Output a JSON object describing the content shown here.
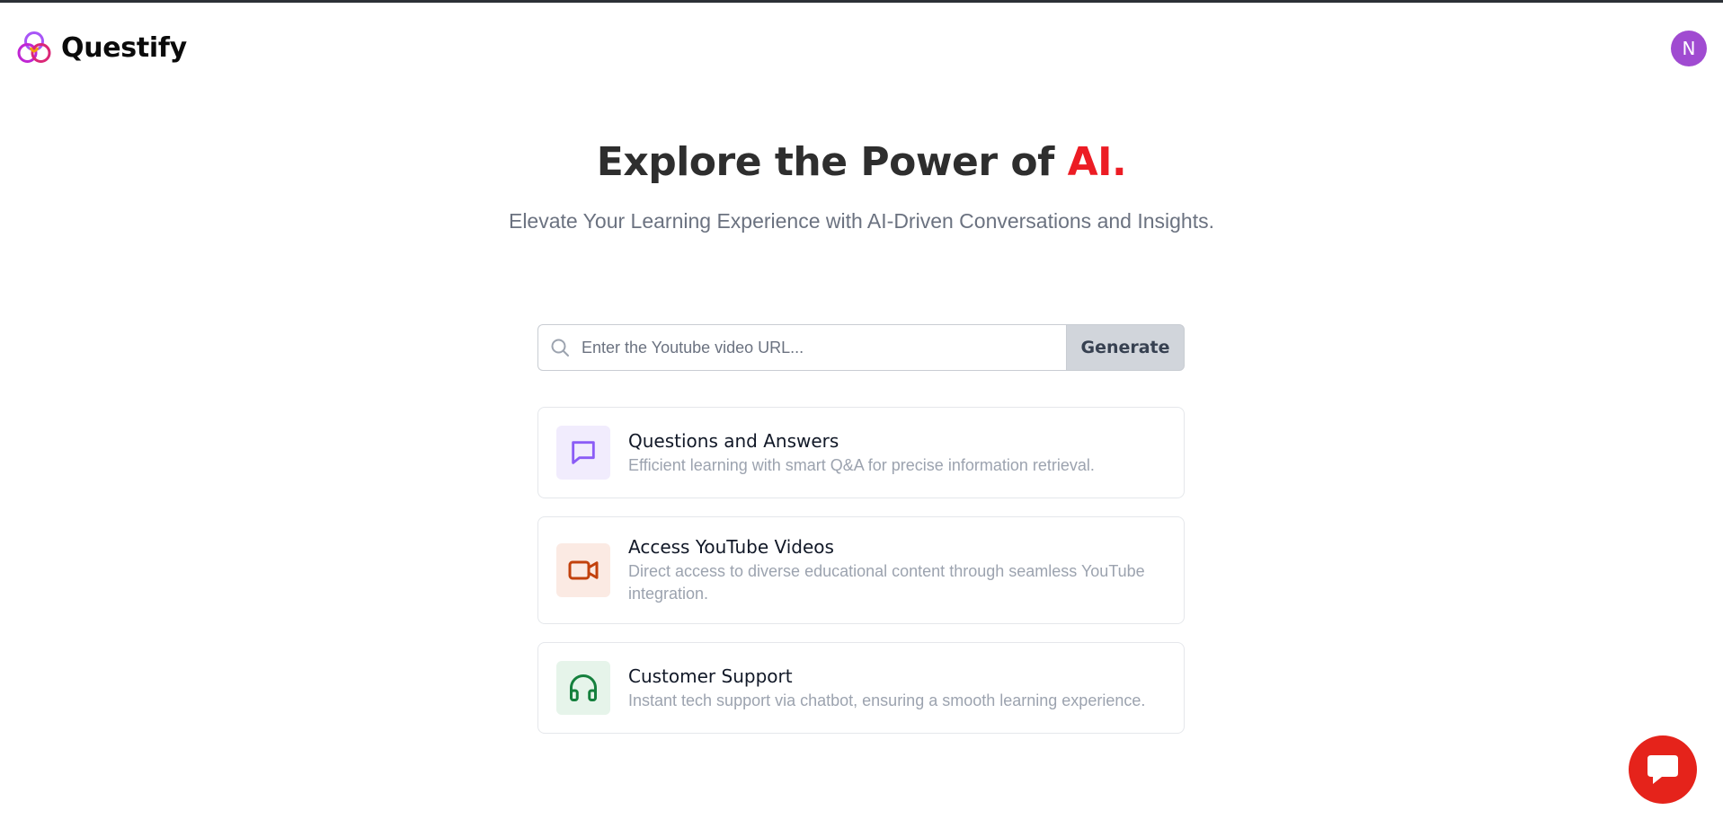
{
  "brand": {
    "name": "Questify",
    "logo_icon": "interlocking-rings-logo"
  },
  "user": {
    "avatar_initial": "N",
    "avatar_color": "#a04bd1"
  },
  "hero": {
    "title_prefix": "Explore the Power of ",
    "title_accent": "AI.",
    "accent_color": "#ec1c24",
    "subtitle": "Elevate Your Learning Experience with AI-Driven Conversations and Insights."
  },
  "search": {
    "placeholder": "Enter the Youtube video URL...",
    "value": "",
    "icon": "search-icon",
    "button_label": "Generate"
  },
  "features": [
    {
      "title": "Questions and Answers",
      "description": "Efficient learning with smart Q&A for precise information retrieval.",
      "icon": "chat-bubble-icon",
      "color": "#8b5cf6"
    },
    {
      "title": "Access YouTube Videos",
      "description": "Direct access to diverse educational content through seamless YouTube integration.",
      "icon": "video-camera-icon",
      "color": "#c2410c"
    },
    {
      "title": "Customer Support",
      "description": "Instant tech support via chatbot, ensuring a smooth learning experience.",
      "icon": "headphones-icon",
      "color": "#15803d"
    }
  ],
  "chat_widget": {
    "icon": "chat-icon",
    "color": "#e5231b"
  }
}
